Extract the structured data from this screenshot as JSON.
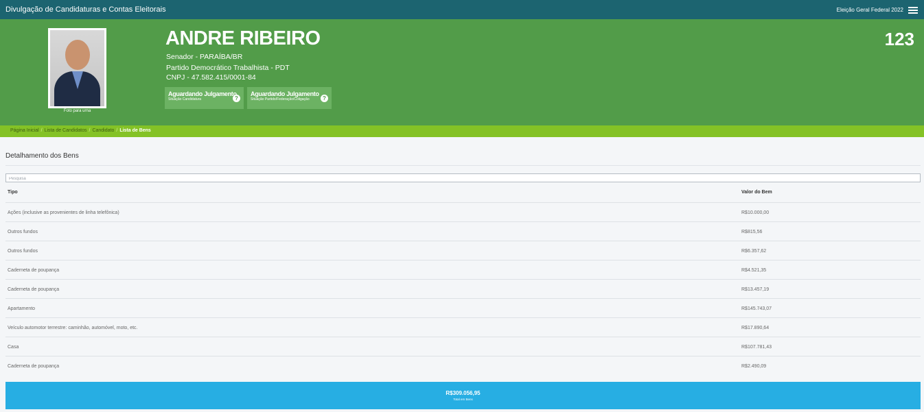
{
  "header": {
    "app_title": "Divulgação de Candidaturas e Contas Eleitorais",
    "election": "Eleição Geral Federal 2022",
    "menu_icon": "hamburger-menu-icon"
  },
  "candidate": {
    "photo_caption": "Foto para urna",
    "name": "ANDRE RIBEIRO",
    "office": "Senador - PARAÍBA/BR",
    "party": "Partido Democrático Trabalhista - PDT",
    "cnpj": "CNPJ - 47.582.415/0001-84",
    "number": "123",
    "status_candidate": {
      "title": "Aguardando Julgamento",
      "subtitle": "Situação Candidatura"
    },
    "status_party": {
      "title": "Aguardando Julgamento",
      "subtitle": "Situação Partido/Federação/Coligação"
    },
    "help_icon": "question-circle-icon"
  },
  "breadcrumb": [
    "Página Inicial",
    "Lista de Candidatos",
    "Candidato",
    "Lista de Bens"
  ],
  "assets": {
    "title": "Detalhamento dos Bens",
    "search_placeholder": "Pesquisa",
    "columns": [
      "Tipo",
      "Valor do Bem"
    ],
    "rows": [
      {
        "tipo": "Ações (inclusive as provenientes de linha telefônica)",
        "valor": "R$10.000,00"
      },
      {
        "tipo": "Outros fundos",
        "valor": "R$815,56"
      },
      {
        "tipo": "Outros fundos",
        "valor": "R$6.357,62"
      },
      {
        "tipo": "Caderneta de poupança",
        "valor": "R$4.521,35"
      },
      {
        "tipo": "Caderneta de poupança",
        "valor": "R$13.457,19"
      },
      {
        "tipo": "Apartamento",
        "valor": "R$145.743,07"
      },
      {
        "tipo": "Veículo automotor terrestre: caminhão, automóvel, moto, etc.",
        "valor": "R$17.890,64"
      },
      {
        "tipo": "Casa",
        "valor": "R$107.781,43"
      },
      {
        "tipo": "Caderneta de poupança",
        "valor": "R$2.490,09"
      }
    ],
    "total_value": "R$309.056,95",
    "total_label": "Total em Bens"
  },
  "colors": {
    "topbar": "#1c6470",
    "hero": "#529c49",
    "breadcrumb": "#84c226",
    "total_bar": "#27aee3"
  }
}
